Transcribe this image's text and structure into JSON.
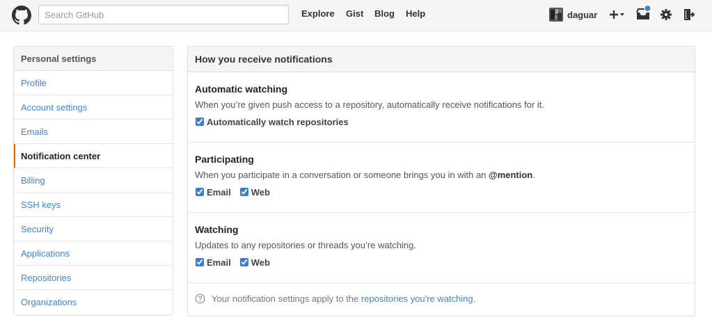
{
  "header": {
    "search_placeholder": "Search GitHub",
    "nav": {
      "explore": "Explore",
      "gist": "Gist",
      "blog": "Blog",
      "help": "Help"
    },
    "username": "daguar"
  },
  "sidebar": {
    "heading": "Personal settings",
    "items": {
      "profile": "Profile",
      "account": "Account settings",
      "emails": "Emails",
      "notifications": "Notification center",
      "billing": "Billing",
      "ssh": "SSH keys",
      "security": "Security",
      "applications": "Applications",
      "repositories": "Repositories",
      "organizations": "Organizations"
    },
    "active_item": "Notification center",
    "accent_color": "#d26911"
  },
  "panel": {
    "heading": "How you receive notifications",
    "automatic": {
      "title": "Automatic watching",
      "description": "When you’re given push access to a repository, automatically receive notifications for it.",
      "checkbox_label": "Automatically watch repositories",
      "checked": true
    },
    "participating": {
      "title": "Participating",
      "description_prefix": "When you participate in a conversation or someone brings you in with an ",
      "mention": "@mention",
      "description_suffix": ".",
      "email_label": "Email",
      "web_label": "Web",
      "email_checked": true,
      "web_checked": true
    },
    "watching": {
      "title": "Watching",
      "description": "Updates to any repositories or threads you’re watching.",
      "email_label": "Email",
      "web_label": "Web",
      "email_checked": true,
      "web_checked": true
    },
    "footer": {
      "text": "Your notification settings apply to the ",
      "link": "repositories you're watching",
      "suffix": "."
    }
  },
  "colors": {
    "link": "#4183c4",
    "notification_dot": "#4183c4"
  }
}
